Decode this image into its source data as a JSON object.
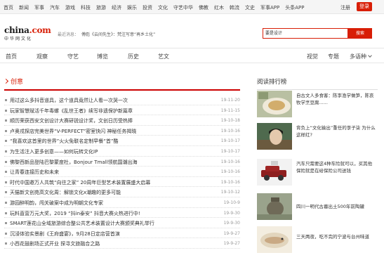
{
  "topbar": {
    "nav": [
      "首页",
      "新闻",
      "军事",
      "汽车",
      "游戏",
      "科技",
      "旅游",
      "经济",
      "娱乐",
      "投资",
      "文化",
      "守艺中华",
      "佛教",
      "红木",
      "韩流",
      "文史",
      "军事APP",
      "头条APP"
    ],
    "login": "注册",
    "register": "登录"
  },
  "header": {
    "logo": "china.com",
    "logo_sub": "中华网文化",
    "latest_label": "最近消息：",
    "latest_text": "傅彪《云间先生》：梵注写意“再乡土化”",
    "search_value": "要是设计",
    "search_button": "搜索"
  },
  "mainnav": {
    "items": [
      "首页",
      "观察",
      "守艺",
      "博览",
      "历史",
      "艺文"
    ],
    "right": [
      "视觉",
      "专题",
      "多语种"
    ]
  },
  "section": {
    "title": "创意"
  },
  "articles": [
    {
      "title": "用过这么多抖音道具，这个道具竟然让人看一次哭一次",
      "date": "19-11-20"
    },
    {
      "title": "玩家智慧赋活千年毒螺《乱世王者》续写非遗保护新篇章",
      "date": "19-11-15"
    },
    {
      "title": "顺历荣获西安文创设计大赛研锐设计奖，文创日历受热捧",
      "date": "19-10-18"
    },
    {
      "title": "卢奥戎探店完美世界“V-PERFECT”密室快闪 神秘任务揭晓",
      "date": "19-10-16"
    },
    {
      "title": "“我喜欢这首里的世界”火火免联名定制早餐“首”酷",
      "date": "19-10-17"
    },
    {
      "title": "为生活注入更多创意——如何玩转文化IP",
      "date": "19-10-17"
    },
    {
      "title": "佛黎西新品登陆巴黎蒙度杜，Bonjour Tmall领航国潮出海",
      "date": "19-10-16"
    },
    {
      "title": "让青春连接历史和未来",
      "date": "19-10-16"
    },
    {
      "title": "时代中国邀万人共筑“向往之家” 20周年巨型艺术装置展盛大启幕",
      "date": "19-10-16"
    },
    {
      "title": "天猫新文创苑高文化周：解锁文化x潮趣的更多可能",
      "date": "19-10-12"
    },
    {
      "title": "游园醉明韵，闯关破案中成为明朝文化专家",
      "date": "19-10-9"
    },
    {
      "title": "玩料直营万元大奖，2019 “抖in泰安” 抖音大赛火热进行中!",
      "date": "19-9-30"
    },
    {
      "title": "SMART莲花山全域旅游综合整公共艺术装置设计大赛颁奖典礼举行",
      "date": "19-9-30"
    },
    {
      "title": "沉浸体验实景剧《王府盛宴》，9月28日定店营首演",
      "date": "19-9-27"
    },
    {
      "title": "小西花鼓剧场正式开业 探寻文旅融合之路",
      "date": "19-9-27"
    }
  ],
  "sidebar": {
    "title": "阅读排行榜",
    "items": [
      {
        "text": "自古文人多食客：陈李渔学做笋，陈哀牧学烹豆腐......",
        "thumb": "food-thumbnail"
      },
      {
        "text": "背负上“文化输出”重任的李子柒 为什么这样红?",
        "thumb": "portrait-thumbnail"
      },
      {
        "text": "汽车只需要这4种车险就可以，买其他保险就是在给保险公司送钱",
        "thumb": "car-thumbnail"
      },
      {
        "text": "四川一明代古墓出土500年前陶罐",
        "thumb": "pottery-thumbnail"
      },
      {
        "text": "三天两夜，吃不完的宁波与台州味道",
        "thumb": "fish-thumbnail"
      }
    ]
  },
  "colors": {
    "accent": "#d81e06",
    "rule": "#c00000"
  }
}
